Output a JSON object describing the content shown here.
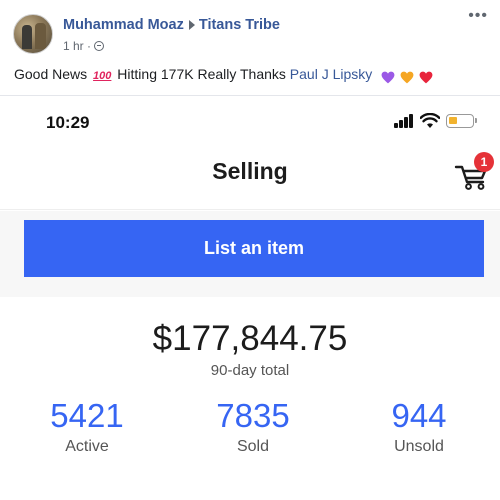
{
  "post": {
    "author": "Muhammad Moaz",
    "group": "Titans Tribe",
    "time": "1 hr ·",
    "more": "•••",
    "text_before": "Good News",
    "emoji_100": "100",
    "text_middle": "Hitting 177K Really Thanks",
    "mention": "Paul J Lipsky",
    "hearts": [
      {
        "icon": "purple-heart-icon",
        "color": "#9b59e6"
      },
      {
        "icon": "orange-heart-icon",
        "color": "#f5a623"
      },
      {
        "icon": "red-heart-icon",
        "color": "#e8243c"
      }
    ]
  },
  "phone": {
    "status_bar": {
      "time": "10:29",
      "battery_fraction": 0.35
    },
    "nav": {
      "title": "Selling",
      "cart_badge": "1"
    },
    "list_button_label": "List an item",
    "summary": {
      "total": "$177,844.75",
      "total_label": "90-day total",
      "stats": [
        {
          "value": "5421",
          "label": "Active"
        },
        {
          "value": "7835",
          "label": "Sold"
        },
        {
          "value": "944",
          "label": "Unsold"
        }
      ]
    }
  },
  "colors": {
    "facebook_link": "#385898",
    "ebay_blue": "#3665f3",
    "badge_red": "#e53238"
  }
}
